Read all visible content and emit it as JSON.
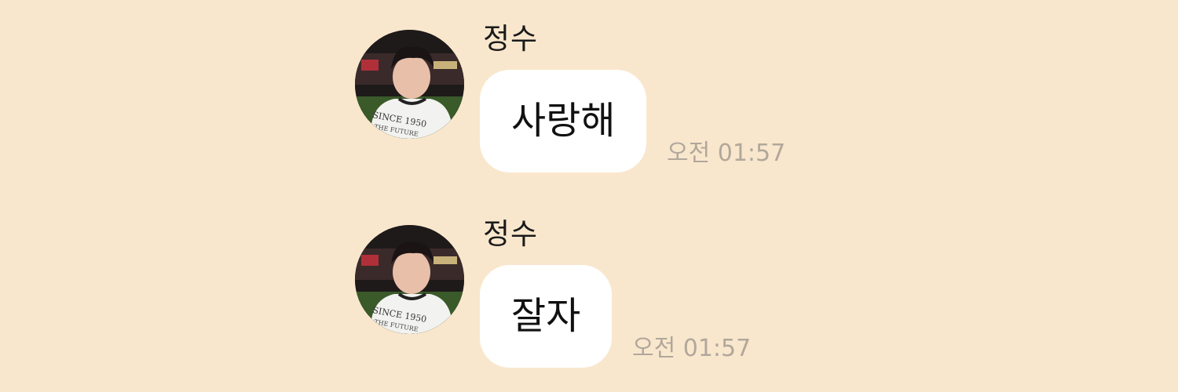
{
  "messages": [
    {
      "sender": "정수",
      "avatar_icon": "profile-photo",
      "text": "사랑해",
      "time": "오전 01:57",
      "shirt_text": [
        "SINCE 1950",
        "THE FUTURE"
      ]
    },
    {
      "sender": "정수",
      "avatar_icon": "profile-photo",
      "text": "잘자",
      "time": "오전 01:57",
      "shirt_text": [
        "SINCE 1950",
        "THE FUTURE"
      ]
    }
  ],
  "colors": {
    "background": "#f9e7cd",
    "bubble": "#ffffff",
    "timestamp": "#b1a79b",
    "sender": "#1a1a1a"
  }
}
